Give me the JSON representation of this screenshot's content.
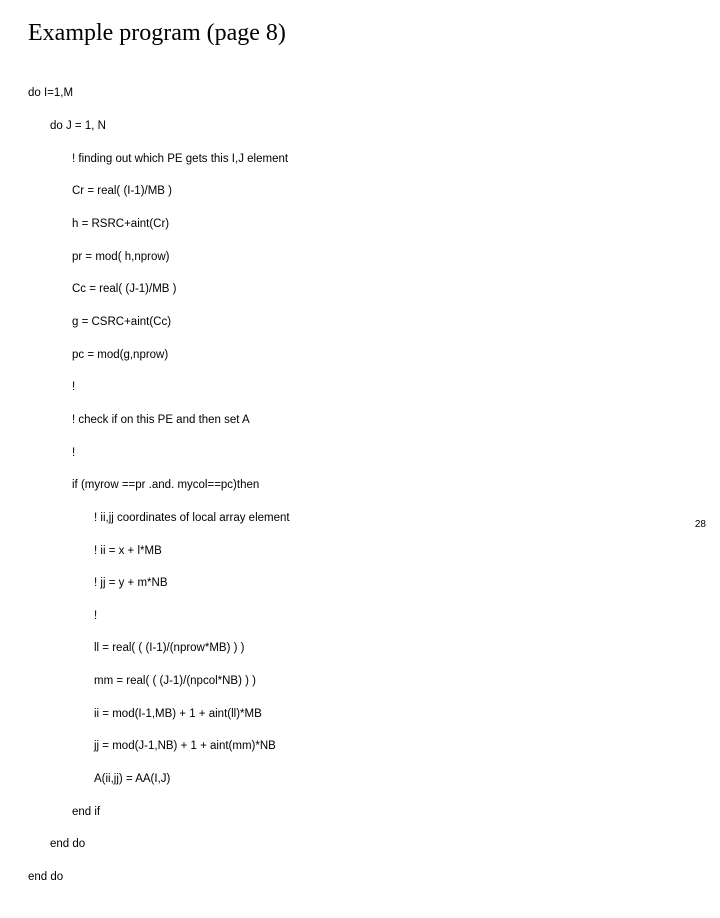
{
  "title": "Example program (page 8)",
  "code": {
    "l0": "do I=1,M",
    "l1": "do J = 1, N",
    "l2": "! finding out which PE gets this I,J element",
    "l3": "Cr = real( (I-1)/MB )",
    "l4": "h = RSRC+aint(Cr)",
    "l5": "pr = mod( h,nprow)",
    "l6": "Cc = real( (J-1)/MB )",
    "l7": "g = CSRC+aint(Cc)",
    "l8": "pc = mod(g,nprow)",
    "l9": "!",
    "l10": "! check if on this PE and then set A",
    "l11": "!",
    "l12": "if (myrow ==pr .and. mycol==pc)then",
    "l13": "! ii,jj coordinates of local array element",
    "l14": "! ii = x + l*MB",
    "l15": "! jj = y + m*NB",
    "l16": "!",
    "l17": "ll = real( ( (I-1)/(nprow*MB) ) )",
    "l18": "mm = real( ( (J-1)/(npcol*NB) ) )",
    "l19": "ii = mod(I-1,MB) + 1 + aint(ll)*MB",
    "l20": "jj = mod(J-1,NB) + 1 + aint(mm)*NB",
    "l21": "A(ii,jj) = AA(I,J)",
    "l22": "end if",
    "l23": "end do",
    "l24": "end do"
  },
  "page_number": "28"
}
